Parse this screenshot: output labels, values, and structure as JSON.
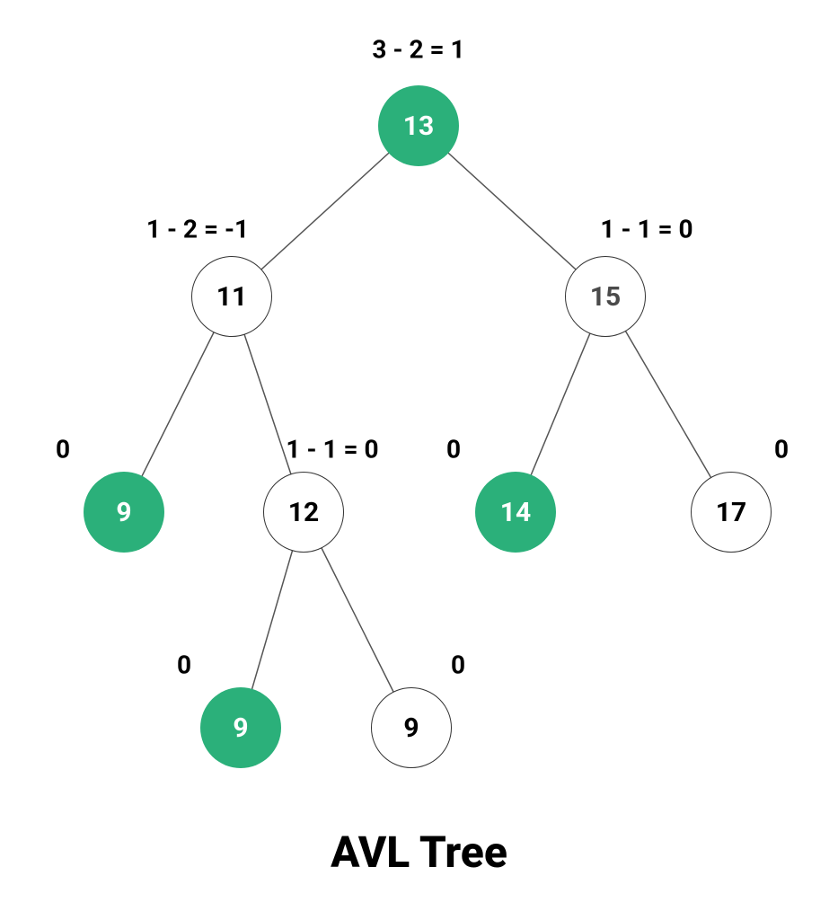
{
  "title": "AVL Tree",
  "colors": {
    "green": "#2bb07a",
    "white": "#ffffff",
    "line": "#555"
  },
  "nodes": {
    "n13": {
      "value": "13",
      "balance": "3 - 2 = 1",
      "filled": true
    },
    "n11": {
      "value": "11",
      "balance": "1 - 2 = -1",
      "filled": false
    },
    "n15": {
      "value": "15",
      "balance": "1 - 1 = 0",
      "filled": false
    },
    "n9a": {
      "value": "9",
      "balance": "0",
      "filled": true
    },
    "n12": {
      "value": "12",
      "balance": "1 - 1 = 0",
      "filled": false
    },
    "n14": {
      "value": "14",
      "balance": "0",
      "filled": true
    },
    "n17": {
      "value": "17",
      "balance": "0",
      "filled": false
    },
    "n9b": {
      "value": "9",
      "balance": "0",
      "filled": true
    },
    "n9c": {
      "value": "9",
      "balance": "0",
      "filled": false
    }
  },
  "edges": [
    [
      "n13",
      "n11"
    ],
    [
      "n13",
      "n15"
    ],
    [
      "n11",
      "n9a"
    ],
    [
      "n11",
      "n12"
    ],
    [
      "n15",
      "n14"
    ],
    [
      "n15",
      "n17"
    ],
    [
      "n12",
      "n9b"
    ],
    [
      "n12",
      "n9c"
    ]
  ]
}
